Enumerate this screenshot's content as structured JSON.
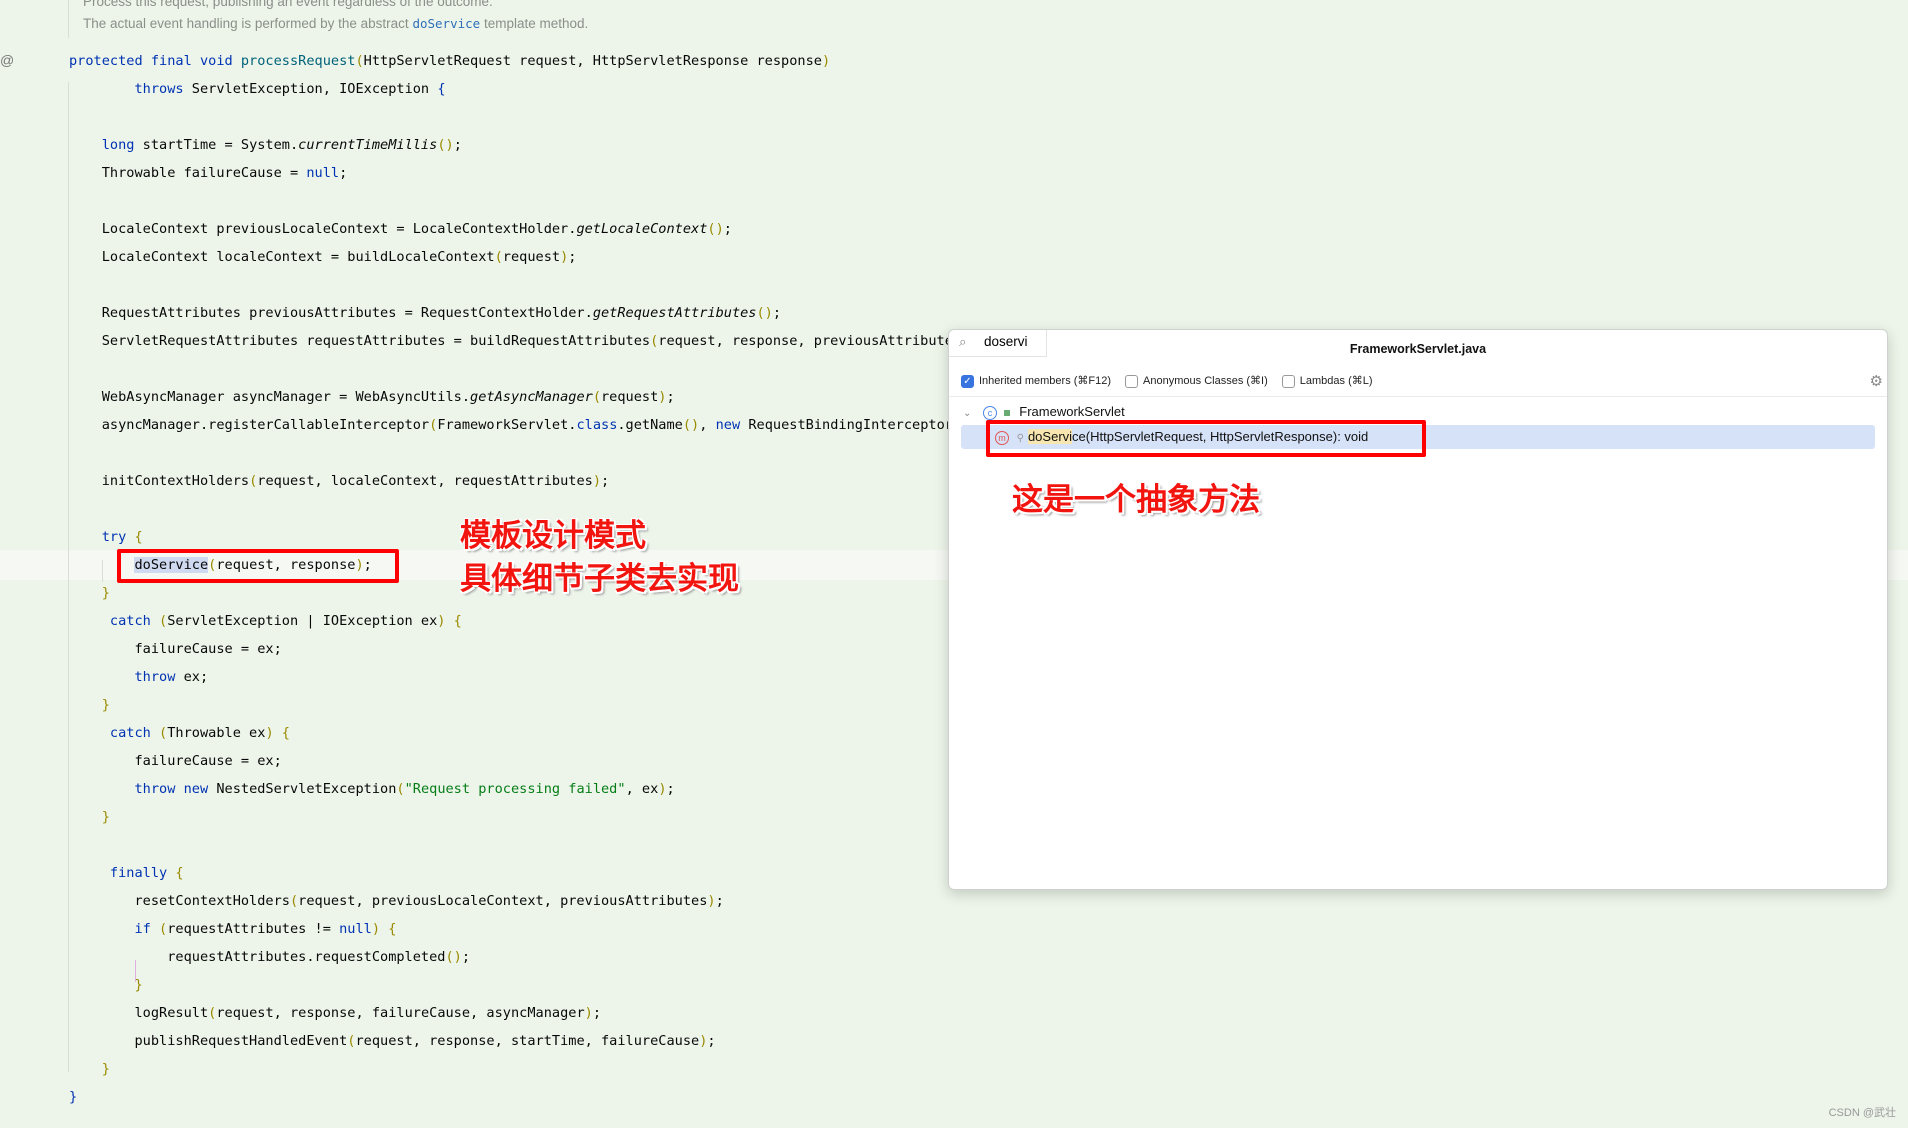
{
  "doc_comment": {
    "line1": "Process this request, publishing an event regardless of the outcome.",
    "line2_before": "The actual event handling is performed by the abstract ",
    "line2_link": "doService",
    "line2_after": " template method."
  },
  "gutter": {
    "icon": "at-override-icon",
    "glyph": "@"
  },
  "code_lines": [
    {
      "row": 0,
      "indent": 0,
      "tokens": [
        [
          "kw",
          "protected final void "
        ],
        [
          "fn",
          "processRequest"
        ],
        [
          "br",
          "("
        ],
        [
          "",
          "HttpServletRequest request, HttpServletResponse response"
        ],
        [
          "br",
          ")"
        ]
      ]
    },
    {
      "row": 1,
      "indent": 8,
      "tokens": [
        [
          "kw",
          "throws "
        ],
        [
          "",
          "ServletException, IOException "
        ],
        [
          "kw",
          "{"
        ]
      ]
    },
    {
      "row": 3,
      "indent": 4,
      "tokens": [
        [
          "kw",
          "long "
        ],
        [
          "",
          "startTime = System."
        ],
        [
          "it",
          "currentTimeMillis"
        ],
        [
          "br",
          "()"
        ],
        [
          "",
          ";"
        ]
      ]
    },
    {
      "row": 4,
      "indent": 4,
      "tokens": [
        [
          "",
          "Throwable failureCause = "
        ],
        [
          "kw",
          "null"
        ],
        [
          "",
          ";"
        ]
      ]
    },
    {
      "row": 6,
      "indent": 4,
      "tokens": [
        [
          "",
          "LocaleContext previousLocaleContext = LocaleContextHolder."
        ],
        [
          "it",
          "getLocaleContext"
        ],
        [
          "br",
          "()"
        ],
        [
          "",
          ";"
        ]
      ]
    },
    {
      "row": 7,
      "indent": 4,
      "tokens": [
        [
          "",
          "LocaleContext localeContext = buildLocaleContext"
        ],
        [
          "br",
          "("
        ],
        [
          "",
          "request"
        ],
        [
          "br",
          ")"
        ],
        [
          "",
          ";"
        ]
      ]
    },
    {
      "row": 9,
      "indent": 4,
      "tokens": [
        [
          "",
          "RequestAttributes previousAttributes = RequestContextHolder."
        ],
        [
          "it",
          "getRequestAttributes"
        ],
        [
          "br",
          "()"
        ],
        [
          "",
          ";"
        ]
      ]
    },
    {
      "row": 10,
      "indent": 4,
      "tokens": [
        [
          "",
          "ServletRequestAttributes requestAttributes = buildRequestAttributes"
        ],
        [
          "br",
          "("
        ],
        [
          "",
          "request, response, previousAttributes"
        ],
        [
          "br",
          ")"
        ],
        [
          "",
          ";"
        ]
      ]
    },
    {
      "row": 12,
      "indent": 4,
      "tokens": [
        [
          "",
          "WebAsyncManager asyncManager = WebAsyncUtils."
        ],
        [
          "it",
          "getAsyncManager"
        ],
        [
          "br",
          "("
        ],
        [
          "",
          "request"
        ],
        [
          "br",
          ")"
        ],
        [
          "",
          ";"
        ]
      ]
    },
    {
      "row": 13,
      "indent": 4,
      "tokens": [
        [
          "",
          "asyncManager.registerCallableInterceptor"
        ],
        [
          "br",
          "("
        ],
        [
          "",
          "FrameworkServlet."
        ],
        [
          "kw",
          "class"
        ],
        [
          "",
          ".getName"
        ],
        [
          "br",
          "()"
        ],
        [
          "",
          ", "
        ],
        [
          "kw",
          "new "
        ],
        [
          "",
          "RequestBindingInterceptor"
        ],
        [
          "br",
          "())"
        ],
        [
          "",
          ";"
        ]
      ]
    },
    {
      "row": 15,
      "indent": 4,
      "tokens": [
        [
          "",
          "initContextHolders"
        ],
        [
          "br",
          "("
        ],
        [
          "",
          "request, localeContext, requestAttributes"
        ],
        [
          "br",
          ")"
        ],
        [
          "",
          ";"
        ]
      ]
    },
    {
      "row": 17,
      "indent": 4,
      "tokens": [
        [
          "kw",
          "try "
        ],
        [
          "br",
          "{"
        ]
      ]
    },
    {
      "row": 18,
      "indent": 8,
      "tokens": [
        [
          "hl",
          "doService"
        ],
        [
          "br",
          "("
        ],
        [
          "",
          "request, response"
        ],
        [
          "br",
          ")"
        ],
        [
          "",
          ";"
        ]
      ]
    },
    {
      "row": 19,
      "indent": 4,
      "tokens": [
        [
          "br",
          "}"
        ]
      ]
    },
    {
      "row": 20,
      "indent": 5,
      "tokens": [
        [
          "kw",
          "catch "
        ],
        [
          "br",
          "("
        ],
        [
          "",
          "ServletException | IOException ex"
        ],
        [
          "br",
          ") {"
        ]
      ]
    },
    {
      "row": 21,
      "indent": 8,
      "tokens": [
        [
          "",
          "failureCause = ex;"
        ]
      ]
    },
    {
      "row": 22,
      "indent": 8,
      "tokens": [
        [
          "kw",
          "throw "
        ],
        [
          "",
          "ex;"
        ]
      ]
    },
    {
      "row": 23,
      "indent": 4,
      "tokens": [
        [
          "br",
          "}"
        ]
      ]
    },
    {
      "row": 24,
      "indent": 5,
      "tokens": [
        [
          "kw",
          "catch "
        ],
        [
          "br",
          "("
        ],
        [
          "",
          "Throwable ex"
        ],
        [
          "br",
          ") {"
        ]
      ]
    },
    {
      "row": 25,
      "indent": 8,
      "tokens": [
        [
          "",
          "failureCause = ex;"
        ]
      ]
    },
    {
      "row": 26,
      "indent": 8,
      "tokens": [
        [
          "kw",
          "throw new "
        ],
        [
          "",
          "NestedServletException"
        ],
        [
          "br",
          "("
        ],
        [
          "st",
          "\"Request processing failed\""
        ],
        [
          "",
          ", ex"
        ],
        [
          "br",
          ")"
        ],
        [
          "",
          ";"
        ]
      ]
    },
    {
      "row": 27,
      "indent": 4,
      "tokens": [
        [
          "br",
          "}"
        ]
      ]
    },
    {
      "row": 29,
      "indent": 5,
      "tokens": [
        [
          "kw",
          "finally "
        ],
        [
          "br",
          "{"
        ]
      ]
    },
    {
      "row": 30,
      "indent": 8,
      "tokens": [
        [
          "",
          "resetContextHolders"
        ],
        [
          "br",
          "("
        ],
        [
          "",
          "request, previousLocaleContext, previousAttributes"
        ],
        [
          "br",
          ")"
        ],
        [
          "",
          ";"
        ]
      ]
    },
    {
      "row": 31,
      "indent": 8,
      "tokens": [
        [
          "kw",
          "if "
        ],
        [
          "br",
          "("
        ],
        [
          "",
          "requestAttributes != "
        ],
        [
          "kw",
          "null"
        ],
        [
          "br",
          ") {"
        ]
      ]
    },
    {
      "row": 32,
      "indent": 12,
      "tokens": [
        [
          "",
          "requestAttributes.requestCompleted"
        ],
        [
          "br",
          "()"
        ],
        [
          "",
          ";"
        ]
      ]
    },
    {
      "row": 33,
      "indent": 8,
      "tokens": [
        [
          "br",
          "}"
        ]
      ]
    },
    {
      "row": 34,
      "indent": 8,
      "tokens": [
        [
          "",
          "logResult"
        ],
        [
          "br",
          "("
        ],
        [
          "",
          "request, response, failureCause, asyncManager"
        ],
        [
          "br",
          ")"
        ],
        [
          "",
          ";"
        ]
      ]
    },
    {
      "row": 35,
      "indent": 8,
      "tokens": [
        [
          "",
          "publishRequestHandledEvent"
        ],
        [
          "br",
          "("
        ],
        [
          "",
          "request, response, startTime, failureCause"
        ],
        [
          "br",
          ")"
        ],
        [
          "",
          ";"
        ]
      ]
    },
    {
      "row": 36,
      "indent": 4,
      "tokens": [
        [
          "br",
          "}"
        ]
      ]
    },
    {
      "row": 37,
      "indent": 0,
      "tokens": [
        [
          "kw",
          "}"
        ]
      ]
    }
  ],
  "annotations": {
    "template_line1": "模板设计模式",
    "template_line2": "具体细节子类去实现",
    "abstract_note": "这是一个抽象方法"
  },
  "popup": {
    "search_value": "doservi",
    "search_icon": "search-icon",
    "title": "FrameworkServlet.java",
    "options": [
      {
        "label": "Inherited members (⌘F12)",
        "checked": true
      },
      {
        "label": "Anonymous Classes (⌘I)",
        "checked": false
      },
      {
        "label": "Lambdas (⌘L)",
        "checked": false
      }
    ],
    "settings_icon": "gear-icon",
    "class_node": "FrameworkServlet",
    "method_match": "doServi",
    "method_rest": "ce(HttpServletRequest, HttpServletResponse): void"
  },
  "watermark": "CSDN @武壮",
  "colors": {
    "background": "#edf5ea",
    "keyword": "#0033b3",
    "annotation_red": "#ff0000",
    "selection": "#d6e2f8"
  }
}
